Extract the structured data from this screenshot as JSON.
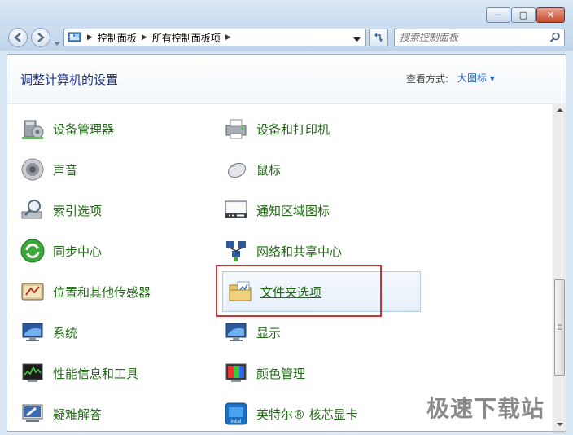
{
  "window": {
    "minimize_glyph": "—",
    "maximize_glyph": "▢",
    "close_glyph": "✕"
  },
  "breadcrumb": {
    "items": [
      {
        "label": "控制面板"
      },
      {
        "label": "所有控制面板项"
      }
    ]
  },
  "search": {
    "placeholder": "搜索控制面板"
  },
  "header": {
    "title": "调整计算机的设置",
    "view_by_label": "查看方式:",
    "view_by_value": "大图标 ▾"
  },
  "items_left": [
    {
      "label": "设备管理器",
      "icon": "device-manager-icon"
    },
    {
      "label": "声音",
      "icon": "speaker-icon"
    },
    {
      "label": "索引选项",
      "icon": "indexing-icon"
    },
    {
      "label": "同步中心",
      "icon": "sync-icon"
    },
    {
      "label": "位置和其他传感器",
      "icon": "sensor-icon"
    },
    {
      "label": "系统",
      "icon": "system-icon"
    },
    {
      "label": "性能信息和工具",
      "icon": "performance-icon"
    },
    {
      "label": "疑难解答",
      "icon": "troubleshoot-icon"
    }
  ],
  "items_right": [
    {
      "label": "设备和打印机",
      "icon": "printer-icon"
    },
    {
      "label": "鼠标",
      "icon": "mouse-icon"
    },
    {
      "label": "通知区域图标",
      "icon": "notification-icon"
    },
    {
      "label": "网络和共享中心",
      "icon": "network-icon"
    },
    {
      "label": "文件夹选项",
      "icon": "folder-icon",
      "selected": true
    },
    {
      "label": "显示",
      "icon": "display-icon"
    },
    {
      "label": "颜色管理",
      "icon": "color-icon"
    },
    {
      "label": "英特尔® 核芯显卡",
      "icon": "intel-graphics-icon"
    }
  ],
  "watermark": "极速下载站",
  "colors": {
    "link_green": "#1f6a13",
    "title_blue": "#1e3287",
    "highlight_red": "#cc3333"
  }
}
